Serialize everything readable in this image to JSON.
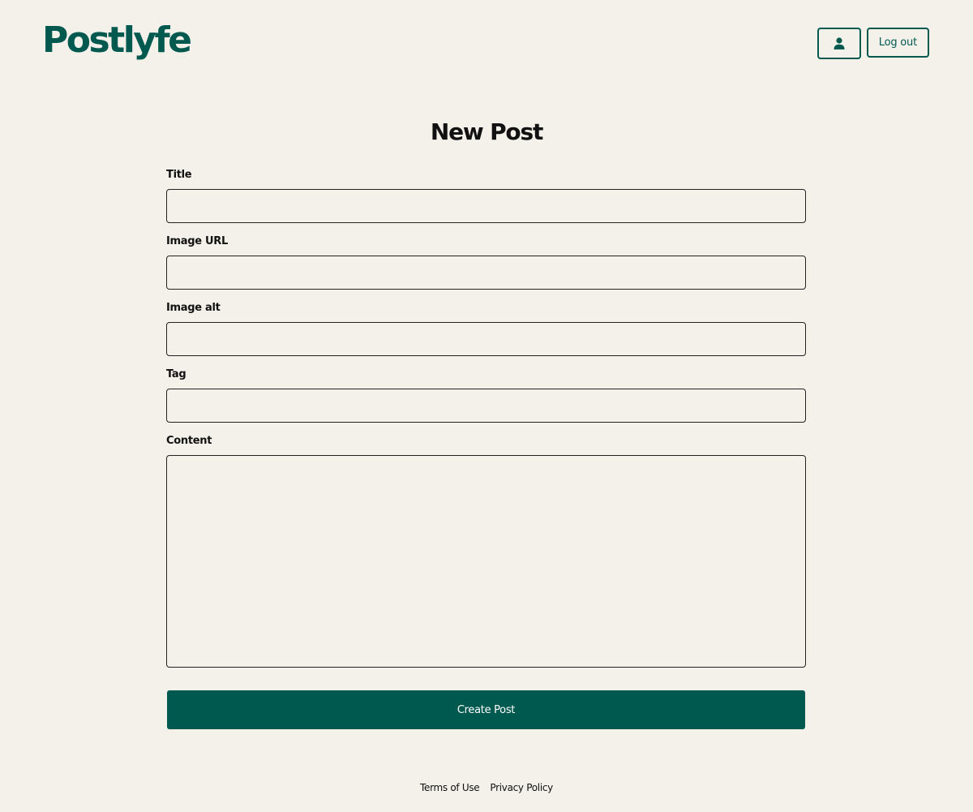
{
  "header": {
    "logo": "Postlyfe",
    "profile_icon": "user-icon",
    "logout_label": "Log out"
  },
  "main": {
    "title": "New Post",
    "fields": {
      "title": {
        "label": "Title",
        "value": ""
      },
      "image_url": {
        "label": "Image URL",
        "value": ""
      },
      "image_alt": {
        "label": "Image alt",
        "value": ""
      },
      "tag": {
        "label": "Tag",
        "value": ""
      },
      "content": {
        "label": "Content",
        "value": ""
      }
    },
    "submit_label": "Create Post"
  },
  "footer": {
    "terms": "Terms of Use",
    "privacy": "Privacy Policy"
  },
  "colors": {
    "brand": "#00594f",
    "background": "#f3f1ea"
  }
}
